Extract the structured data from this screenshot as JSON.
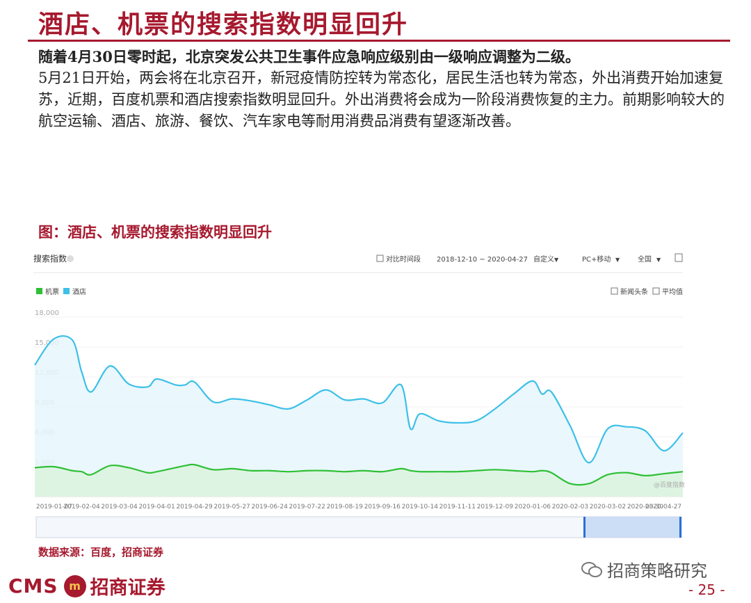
{
  "header": {
    "title": "酒店、机票的搜索指数明显回升"
  },
  "body": {
    "line1": "随着4月30日零时起，北京突发公共卫生事件应急响应级别由一级响应调整为二级。",
    "line2": "5月21日开始，两会将在北京召开，新冠疫情防控转为常态化，居民生活也转为常态，外出消费开始加速复苏，近期，百度机票和酒店搜索指数明显回升。外出消费将会成为一阶段消费恢复的主力。前期影响较大的航空运输、酒店、旅游、餐饮、汽车家电等耐用消费品消费有望逐渐改善。"
  },
  "figure": {
    "title": "图：酒店、机票的搜索指数明显回升",
    "source": "数据来源：百度，招商证券"
  },
  "chart_ui": {
    "panel_title": "搜索指数",
    "compare_label": "对比时间段",
    "date_range": "2018-12-10 ~ 2020-04-27",
    "custom_label": "自定义",
    "device_label": "PC+移动",
    "region_label": "全国",
    "news_label": "新闻头条",
    "avg_label": "平均值",
    "watermark": "@百度指数"
  },
  "colors": {
    "brand": "#a6192e",
    "hotel": "#3cc0e8",
    "flight": "#2ec035"
  },
  "chart_data": {
    "type": "line",
    "ylim": [
      0,
      18000
    ],
    "yticks": [
      "18,000",
      "15,000",
      "12,000",
      "9,000",
      "6,000",
      "3,000"
    ],
    "ytick_values": [
      18000,
      15000,
      12000,
      9000,
      6000,
      3000
    ],
    "xtick_labels": [
      "2019-01-07",
      "2019-02-04",
      "2019-03-04",
      "2019-04-01",
      "2019-04-29",
      "2019-05-27",
      "2019-06-24",
      "2019-07-22",
      "2019-08-19",
      "2019-09-16",
      "2019-10-14",
      "2019-11-11",
      "2019-12-09",
      "2020-01-06",
      "2020-02-03",
      "2020-03-02",
      "2020-03-30",
      "2020-04-27"
    ],
    "legend": [
      "机票",
      "酒店"
    ],
    "x": [
      "2018-12-31",
      "2019-01-14",
      "2019-01-28",
      "2019-02-04",
      "2019-02-11",
      "2019-02-25",
      "2019-03-11",
      "2019-03-25",
      "2019-04-01",
      "2019-04-15",
      "2019-04-22",
      "2019-04-29",
      "2019-05-13",
      "2019-05-27",
      "2019-06-10",
      "2019-06-24",
      "2019-07-08",
      "2019-07-22",
      "2019-08-05",
      "2019-08-19",
      "2019-09-02",
      "2019-09-16",
      "2019-09-30",
      "2019-10-07",
      "2019-10-14",
      "2019-10-28",
      "2019-11-11",
      "2019-11-25",
      "2019-12-09",
      "2019-12-23",
      "2020-01-06",
      "2020-01-13",
      "2020-01-20",
      "2020-02-03",
      "2020-02-17",
      "2020-03-02",
      "2020-03-16",
      "2020-03-30",
      "2020-04-13",
      "2020-04-27"
    ],
    "series": [
      {
        "name": "酒店",
        "values": [
          13200,
          15800,
          15700,
          12500,
          10500,
          13100,
          11300,
          11000,
          11800,
          11200,
          11200,
          11500,
          9500,
          9800,
          9600,
          9200,
          8800,
          9700,
          10700,
          9700,
          9800,
          9400,
          11200,
          6800,
          8300,
          7600,
          7400,
          7600,
          8800,
          10300,
          11600,
          10300,
          10500,
          7100,
          3400,
          6800,
          7000,
          6600,
          4600,
          6400
        ]
      },
      {
        "name": "机票",
        "values": [
          2900,
          3000,
          2600,
          2500,
          2200,
          3100,
          2900,
          2400,
          2500,
          2900,
          3100,
          3200,
          2700,
          2800,
          2600,
          2600,
          2500,
          2600,
          2600,
          2500,
          2600,
          2500,
          2800,
          2600,
          2500,
          2500,
          2500,
          2600,
          2700,
          2600,
          2500,
          2600,
          2400,
          1300,
          1300,
          2200,
          2400,
          2100,
          2300,
          2500
        ]
      }
    ]
  }
}
